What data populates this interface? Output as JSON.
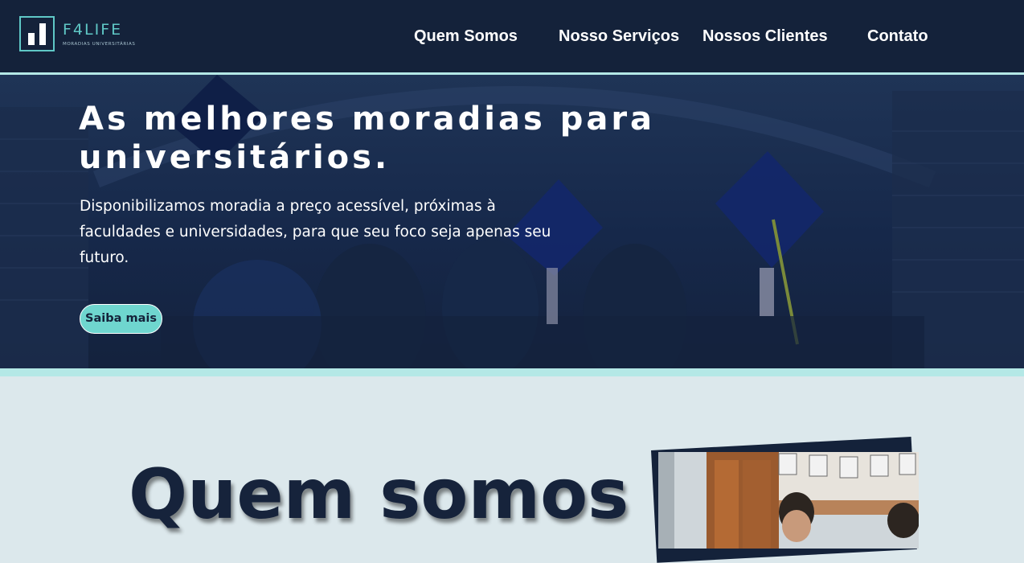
{
  "brand": {
    "name": "F4LIFE",
    "tagline": "MORADIAS UNIVERSITÁRIAS",
    "accent_color": "#5fc8c6",
    "dark_color": "#14223a"
  },
  "nav": {
    "items": [
      {
        "label": "Quem Somos"
      },
      {
        "label": "Nosso Serviços"
      },
      {
        "label": "Nossos Clientes"
      },
      {
        "label": "Contato"
      }
    ]
  },
  "hero": {
    "title": "As melhores moradias para universitários.",
    "description": "Disponibilizamos moradia a preço acessível, próximas à faculdades e universidades, para que seu foco seja apenas seu futuro.",
    "cta_label": "Saiba mais"
  },
  "about": {
    "title": "Quem somos"
  }
}
